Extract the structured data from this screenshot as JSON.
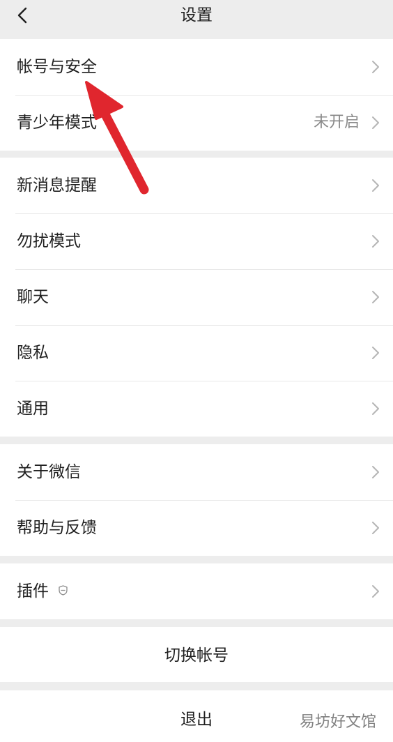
{
  "header": {
    "title": "设置"
  },
  "groups": [
    {
      "items": [
        {
          "label": "帐号与安全"
        },
        {
          "label": "青少年模式",
          "value": "未开启"
        }
      ]
    },
    {
      "items": [
        {
          "label": "新消息提醒"
        },
        {
          "label": "勿扰模式"
        },
        {
          "label": "聊天"
        },
        {
          "label": "隐私"
        },
        {
          "label": "通用"
        }
      ]
    },
    {
      "items": [
        {
          "label": "关于微信"
        },
        {
          "label": "帮助与反馈"
        }
      ]
    },
    {
      "items": [
        {
          "label": "插件"
        }
      ]
    }
  ],
  "actions": {
    "switch_account": "切换帐号",
    "logout": "退出"
  },
  "watermark": "易坊好文馆",
  "colors": {
    "page_background": "#ededed",
    "list_background": "#ffffff",
    "annotation_arrow": "#e0262e"
  },
  "icons": {
    "back": "chevron-left-icon",
    "row_arrow": "chevron-right-icon",
    "plugin_badge": "shield-icon"
  }
}
